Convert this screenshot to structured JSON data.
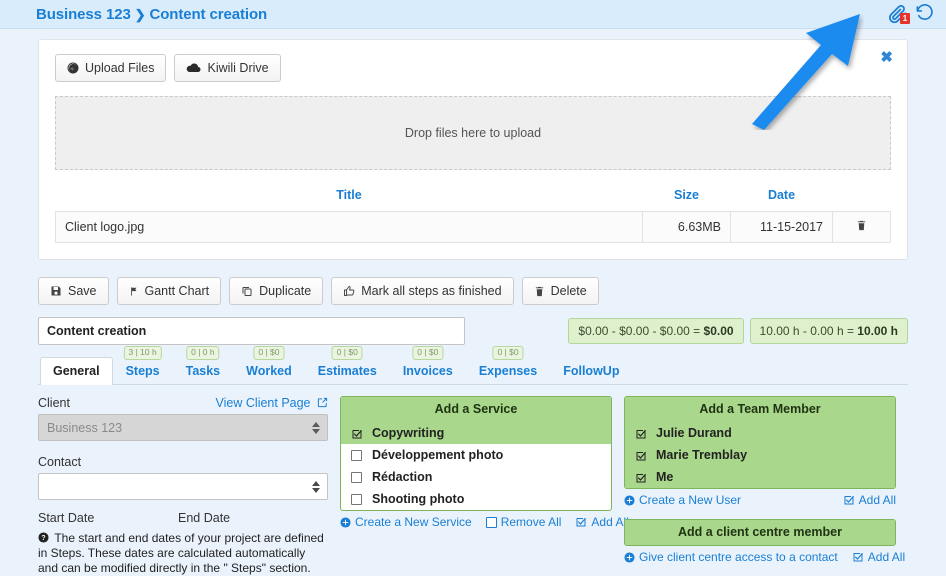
{
  "header": {
    "breadcrumb_client": "Business 123",
    "breadcrumb_sep": "❯",
    "breadcrumb_page": "Content creation",
    "attachment_icon": "paperclip-icon",
    "attachment_count": "1",
    "history_icon": "history-icon"
  },
  "upload": {
    "upload_files_label": "Upload Files",
    "kiwili_drive_label": "Kiwili Drive",
    "dropzone_text": "Drop files here to upload",
    "close_label": "✖",
    "columns": [
      "Title",
      "Size",
      "Date",
      ""
    ],
    "files": [
      {
        "title": "Client logo.jpg",
        "size": "6.63MB",
        "date": "11-15-2017",
        "delete_icon": "trash-icon"
      }
    ]
  },
  "actions": {
    "save": "Save",
    "gantt": "Gantt Chart",
    "duplicate": "Duplicate",
    "mark_finished": "Mark all steps as finished",
    "delete": "Delete"
  },
  "project": {
    "name": "Content creation",
    "money_badge_prefix": "$0.00 - $0.00 - $0.00 = ",
    "money_badge_total": "$0.00",
    "hours_badge_prefix": "10.00 h - 0.00 h = ",
    "hours_badge_total": "10.00 h"
  },
  "tabs": [
    {
      "label": "General",
      "badge": "",
      "active": true
    },
    {
      "label": "Steps",
      "badge": "3 | 10 h",
      "active": false
    },
    {
      "label": "Tasks",
      "badge": "0 | 0 h",
      "active": false
    },
    {
      "label": "Worked",
      "badge": "0 | $0",
      "active": false
    },
    {
      "label": "Estimates",
      "badge": "0 | $0",
      "active": false
    },
    {
      "label": "Invoices",
      "badge": "0 | $0",
      "active": false
    },
    {
      "label": "Expenses",
      "badge": "0 | $0",
      "active": false
    },
    {
      "label": "FollowUp",
      "badge": "",
      "active": false
    }
  ],
  "general": {
    "client_label": "Client",
    "view_client_page": "View Client Page",
    "view_client_icon": "external-link-icon",
    "client_value": "Business 123",
    "contact_label": "Contact",
    "contact_value": "",
    "start_date_label": "Start Date",
    "end_date_label": "End Date",
    "dates_note_icon": "question-circle-icon",
    "dates_note": "The start and end dates of your project are defined in Steps. These dates are calculated automatically and can be modified directly in the \" Steps\" section."
  },
  "services": {
    "title": "Add a Service",
    "items": [
      {
        "label": "Copywriting",
        "checked": true
      },
      {
        "label": "Développement photo",
        "checked": false
      },
      {
        "label": "Rédaction",
        "checked": false
      },
      {
        "label": "Shooting photo",
        "checked": false
      }
    ],
    "create_new": "Create a New Service",
    "remove_all": "Remove All",
    "add_all": "Add All"
  },
  "team": {
    "title": "Add a Team Member",
    "items": [
      {
        "label": "Julie Durand",
        "checked": true
      },
      {
        "label": "Marie Tremblay",
        "checked": true
      },
      {
        "label": "Me",
        "checked": true
      }
    ],
    "create_new": "Create a New User",
    "add_all": "Add All"
  },
  "client_centre": {
    "title": "Add a client centre member",
    "give_access": "Give client centre access to a contact",
    "add_all": "Add All"
  },
  "colors": {
    "header_bg": "#d9ecfb",
    "link_blue": "#1a7fd4",
    "panel_green": "#a9d78b",
    "badge_red": "#e8332a",
    "arrow_blue": "#1f8bf0"
  }
}
